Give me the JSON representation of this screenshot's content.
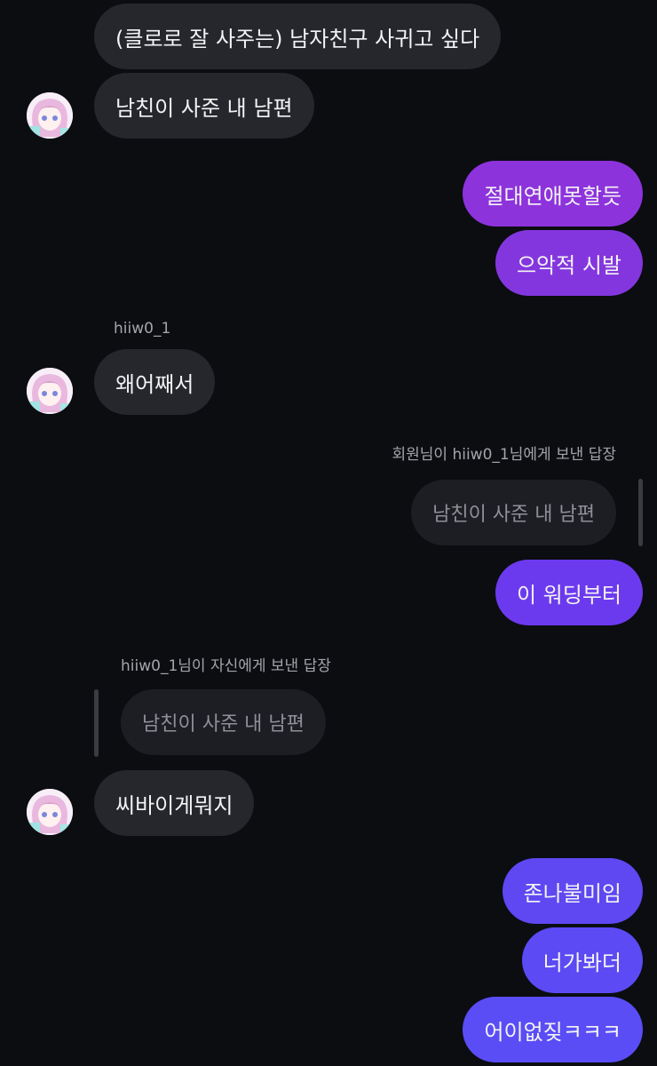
{
  "messages": {
    "m1": "(클로로 잘 사주는) 남자친구 사귀고 싶다",
    "m2": "남친이 사준 내 남편",
    "m3": "절대연애못할듯",
    "m4": "으악적 시발",
    "m5_sender": "hiiw0_1",
    "m5": "왜어째서",
    "m6_reply_label": "회원님이 hiiw0_1님에게 보낸 답장",
    "m6_quote": "남친이 사준 내 남편",
    "m6": "이 워딩부터",
    "m7_reply_label": "hiiw0_1님이 자신에게 보낸 답장",
    "m7_quote": "남친이 사준 내 남편",
    "m7": "씨바이게뭐지",
    "m8": "존나불미임",
    "m9": "너가봐더",
    "m10": "어이없짖ㅋㅋㅋ"
  },
  "colors": {
    "background": "#0b0d11",
    "incoming_bubble": "#25272c",
    "quote_bubble": "#1c1e23",
    "outgoing_purple": "#8f33dc",
    "outgoing_violet": "#6a3cf0",
    "outgoing_indigo": "#5b4cf4"
  },
  "icons": {
    "avatar": "anime-girl-avatar"
  }
}
